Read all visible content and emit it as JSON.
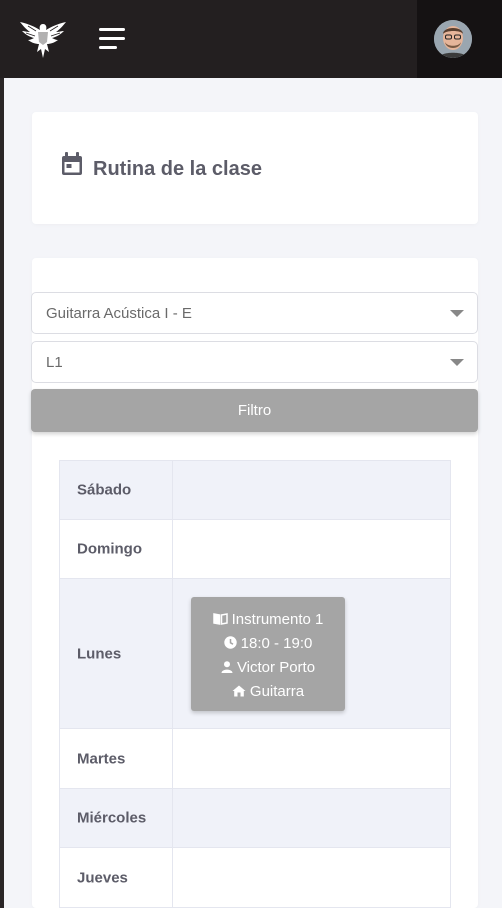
{
  "header": {
    "logo_icon": "eagle-logo-icon",
    "menu_icon": "hamburger-menu-icon",
    "avatar_icon": "user-avatar"
  },
  "title_card": {
    "icon": "calendar-icon",
    "title": "Rutina de la clase"
  },
  "filters": {
    "course_select": {
      "value": "Guitarra Acústica I - E"
    },
    "level_select": {
      "value": "L1"
    },
    "filter_button": "Filtro"
  },
  "routine": {
    "days": [
      {
        "day": "Sábado",
        "classes": []
      },
      {
        "day": "Domingo",
        "classes": []
      },
      {
        "day": "Lunes",
        "classes": [
          {
            "subject": "Instrumento 1",
            "time": "18:0 - 19:0",
            "teacher": "Victor Porto",
            "room": "Guitarra",
            "icons": [
              "book-icon",
              "clock-icon",
              "user-icon",
              "home-icon"
            ]
          }
        ]
      },
      {
        "day": "Martes",
        "classes": []
      },
      {
        "day": "Miércoles",
        "classes": []
      },
      {
        "day": "Jueves",
        "classes": []
      }
    ]
  },
  "colors": {
    "topbar": "#231f20",
    "button_gray": "#a5a5a5",
    "row_alt": "#f0f2f9",
    "text_dark": "#5c5c68"
  }
}
